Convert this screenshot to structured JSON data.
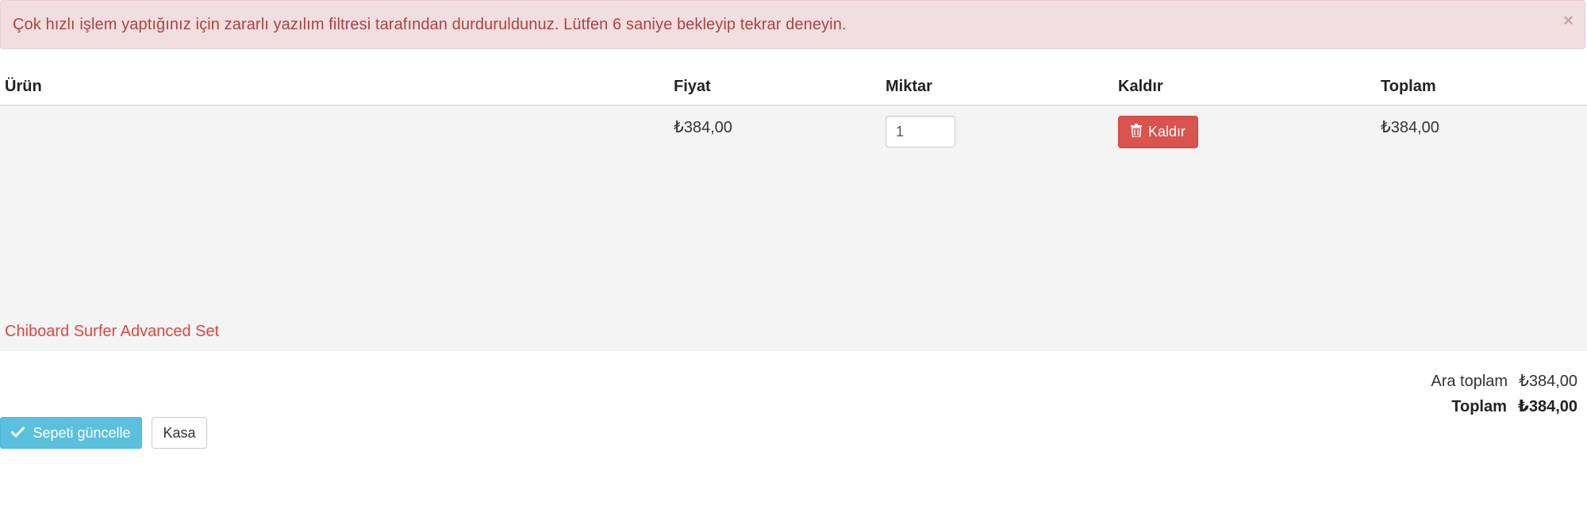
{
  "alert": {
    "message": "Çok hızlı işlem yaptığınız için zararlı yazılım filtresi tarafından durduruldunuz. Lütfen 6 saniye bekleyip tekrar deneyin.",
    "close_symbol": "×",
    "color": "#a94442",
    "background": "#f2dede"
  },
  "cart": {
    "columns": {
      "product": "Ürün",
      "price": "Fiyat",
      "quantity": "Miktar",
      "remove": "Kaldır",
      "total": "Toplam"
    },
    "items": [
      {
        "product_name": "Chiboard Surfer Advanced Set",
        "price": "₺384,00",
        "quantity": "1",
        "remove_label": "Kaldır",
        "remove_icon": "trash-icon",
        "total": "₺384,00"
      }
    ],
    "summary": {
      "subtotal_label": "Ara toplam",
      "subtotal_value": "₺384,00",
      "total_label": "Toplam",
      "total_value": "₺384,00"
    },
    "actions": {
      "update_label": "Sepeti güncelle",
      "update_icon": "check-icon",
      "checkout_label": "Kasa"
    }
  },
  "colors": {
    "danger": "#d9534f",
    "info": "#5bc0de",
    "link": "#e2453d",
    "row_background": "#f4f4f4"
  }
}
